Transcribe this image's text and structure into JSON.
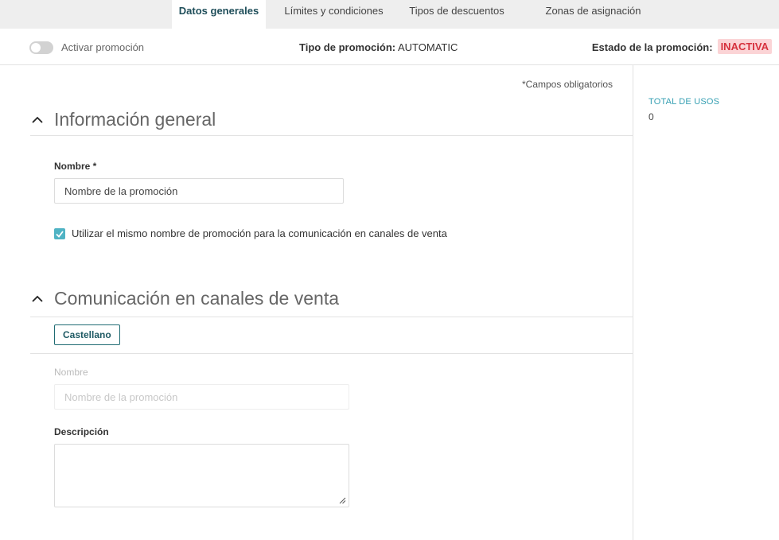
{
  "tabs": [
    {
      "label": "Datos generales",
      "active": true
    },
    {
      "label": "Límites y condiciones",
      "active": false
    },
    {
      "label": "Tipos de descuentos",
      "active": false
    },
    {
      "label": "Zonas de asignación",
      "active": false
    }
  ],
  "status": {
    "toggle_label": "Activar promoción",
    "toggle_on": false,
    "type_label": "Tipo de promoción:",
    "type_value": "AUTOMATIC",
    "state_label": "Estado de la promoción:",
    "state_value": "INACTIVA"
  },
  "required_note": "*Campos obligatorios",
  "side": {
    "total_label": "TOTAL DE USOS",
    "total_value": "0"
  },
  "general": {
    "title": "Información general",
    "name_label": "Nombre *",
    "name_value": "Nombre de la promoción",
    "same_name_checkbox": "Utilizar el mismo nombre de promoción para la comunicación en canales de venta",
    "same_name_checked": true
  },
  "channels": {
    "title": "Comunicación en canales de venta",
    "language_tab": "Castellano",
    "name_label": "Nombre",
    "name_placeholder": "Nombre de la promoción",
    "description_label": "Descripción",
    "description_value": ""
  },
  "colors": {
    "accent": "#4fb3c4",
    "primary_dark": "#1f6b73",
    "danger_text": "#d6313d",
    "danger_bg": "#fbd4d6"
  }
}
